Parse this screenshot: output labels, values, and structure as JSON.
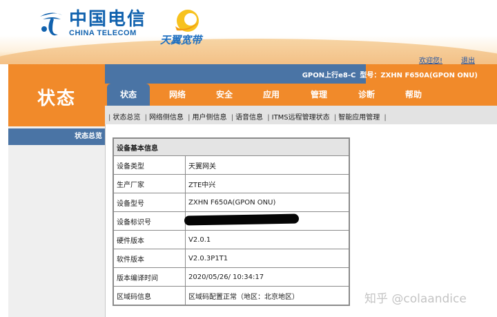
{
  "brand": {
    "ct_cn": "中国电信",
    "ct_en": "CHINA TELECOM",
    "tianyi": "天翼宽带"
  },
  "header": {
    "welcome": "欢迎您!",
    "logout": "退出",
    "gpon": "GPON上行e8-C",
    "model_label": "型号：ZXHN F650A(GPON ONU)"
  },
  "page_title": "状态",
  "tabs": [
    {
      "label": "状态",
      "active": true
    },
    {
      "label": "网络"
    },
    {
      "label": "安全"
    },
    {
      "label": "应用"
    },
    {
      "label": "管理"
    },
    {
      "label": "诊断"
    },
    {
      "label": "帮助"
    }
  ],
  "subnav": [
    "状态总览",
    "网络侧信息",
    "用户侧信息",
    "语音信息",
    "ITMS远程管理状态",
    "智能应用管理"
  ],
  "sidebar": {
    "item": "状态总览"
  },
  "table": {
    "title": "设备基本信息",
    "rows": [
      {
        "label": "设备类型",
        "value": "天翼网关"
      },
      {
        "label": "生产厂家",
        "value": "ZTE中兴"
      },
      {
        "label": "设备型号",
        "value": "ZXHN F650A(GPON ONU)"
      },
      {
        "label": "设备标识号",
        "value": ""
      },
      {
        "label": "硬件版本",
        "value": "V2.0.1"
      },
      {
        "label": "软件版本",
        "value": "V2.0.3P1T1"
      },
      {
        "label": "版本编译时间",
        "value": "2020/05/26/ 10:34:17"
      },
      {
        "label": "区域码信息",
        "value": "区域码配置正常（地区：北京地区）"
      }
    ]
  },
  "watermark": "知乎 @colaandice",
  "colors": {
    "orange": "#f18a2a",
    "blue": "#4a74a5",
    "brand_blue": "#1162ae"
  }
}
